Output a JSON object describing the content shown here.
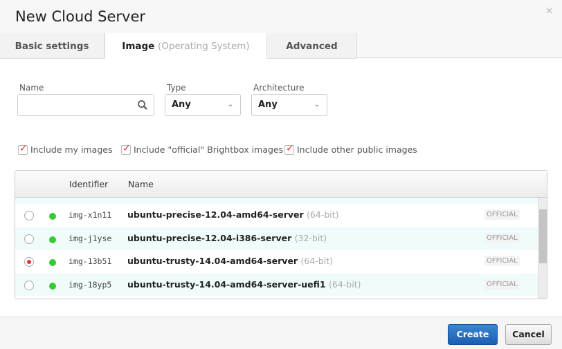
{
  "dialog": {
    "title": "New Cloud Server",
    "close": "×"
  },
  "tabs": [
    {
      "label": "Basic settings"
    },
    {
      "label": "Image",
      "sub": "(Operating System)"
    },
    {
      "label": "Advanced"
    }
  ],
  "filters": {
    "name_label": "Name",
    "name_value": "",
    "type_label": "Type",
    "type_value": "Any",
    "arch_label": "Architecture",
    "arch_value": "Any"
  },
  "checkboxes": [
    {
      "label": "Include my images",
      "checked": true
    },
    {
      "label": "Include \"official\" Brightbox images",
      "checked": true
    },
    {
      "label": "Include other public images",
      "checked": true
    }
  ],
  "table": {
    "headers": {
      "identifier": "Identifier",
      "name": "Name"
    },
    "rows": [
      {
        "id": "img-x1n11",
        "name": "ubuntu-precise-12.04-amd64-server",
        "bits": "(64-bit)",
        "badge": "OFFICIAL",
        "selected": false
      },
      {
        "id": "img-j1yse",
        "name": "ubuntu-precise-12.04-i386-server",
        "bits": "(32-bit)",
        "badge": "OFFICIAL",
        "selected": false
      },
      {
        "id": "img-13b51",
        "name": "ubuntu-trusty-14.04-amd64-server",
        "bits": "(64-bit)",
        "badge": "OFFICIAL",
        "selected": true
      },
      {
        "id": "img-18yp5",
        "name": "ubuntu-trusty-14.04-amd64-server-uefi1",
        "bits": "(64-bit)",
        "badge": "OFFICIAL",
        "selected": false
      }
    ]
  },
  "footer": {
    "create": "Create",
    "cancel": "Cancel"
  }
}
